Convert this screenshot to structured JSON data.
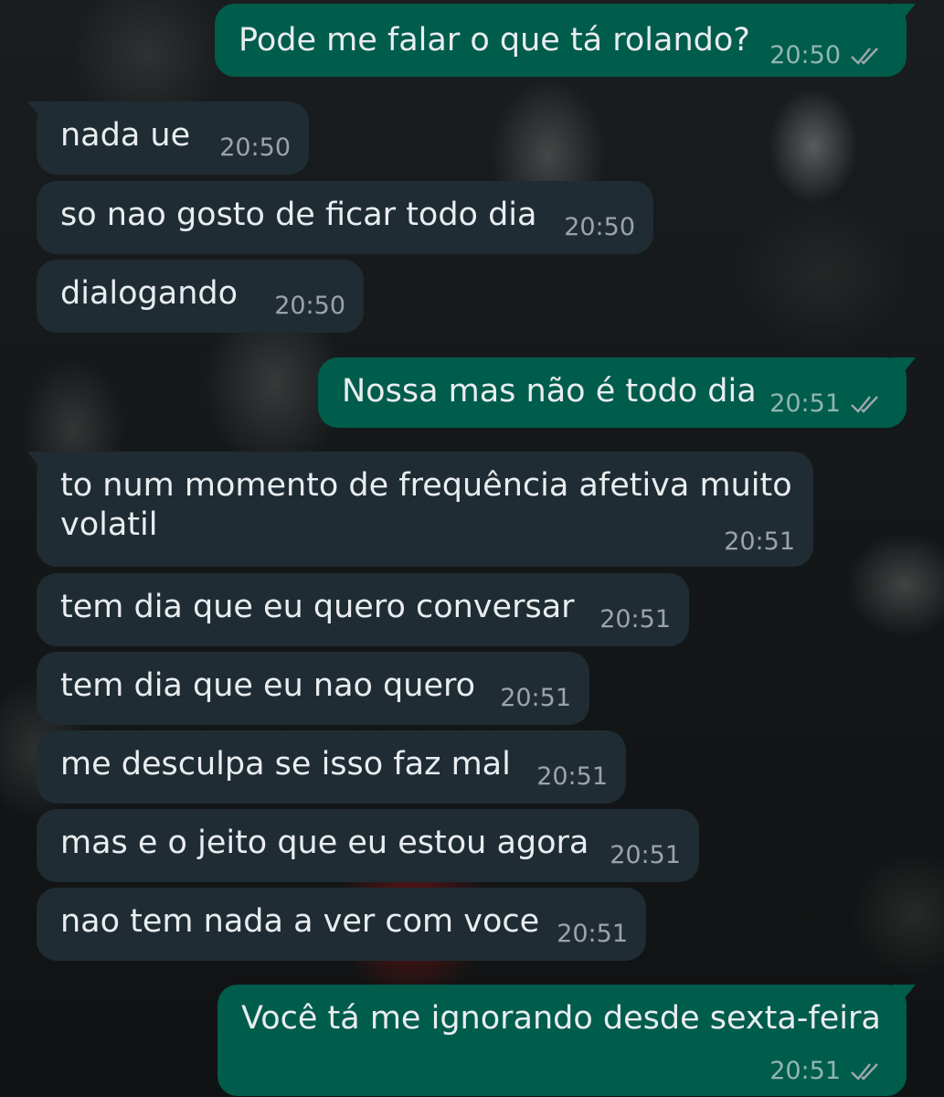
{
  "colors": {
    "incoming_bubble": "#1f2c33",
    "outgoing_bubble": "#005c4b",
    "text": "#e9edef",
    "timestamp": "#9fa8ac"
  },
  "messages": [
    {
      "direction": "out",
      "text": "Pode me falar o que tá rolando?",
      "time": "20:50",
      "status": "read-ticks-icon"
    },
    {
      "direction": "in",
      "text": "nada ue",
      "time": "20:50"
    },
    {
      "direction": "in",
      "text": "so nao gosto de ficar todo dia",
      "time": "20:50"
    },
    {
      "direction": "in",
      "text": "dialogando",
      "time": "20:50"
    },
    {
      "direction": "out",
      "text": "Nossa mas não é todo dia",
      "time": "20:51",
      "status": "read-ticks-icon"
    },
    {
      "direction": "in",
      "text": "to num momento de frequência afetiva muito",
      "text_line2": "volatil",
      "time": "20:51"
    },
    {
      "direction": "in",
      "text": "tem dia que eu quero conversar",
      "time": "20:51"
    },
    {
      "direction": "in",
      "text": "tem dia que eu nao quero",
      "time": "20:51"
    },
    {
      "direction": "in",
      "text": "me desculpa se isso faz mal",
      "time": "20:51"
    },
    {
      "direction": "in",
      "text": "mas e o jeito que eu estou agora",
      "time": "20:51"
    },
    {
      "direction": "in",
      "text": "nao tem nada a ver com voce",
      "time": "20:51"
    },
    {
      "direction": "out",
      "text": "Você tá me ignorando desde sexta-feira",
      "time": "20:51",
      "status": "read-ticks-icon"
    }
  ]
}
